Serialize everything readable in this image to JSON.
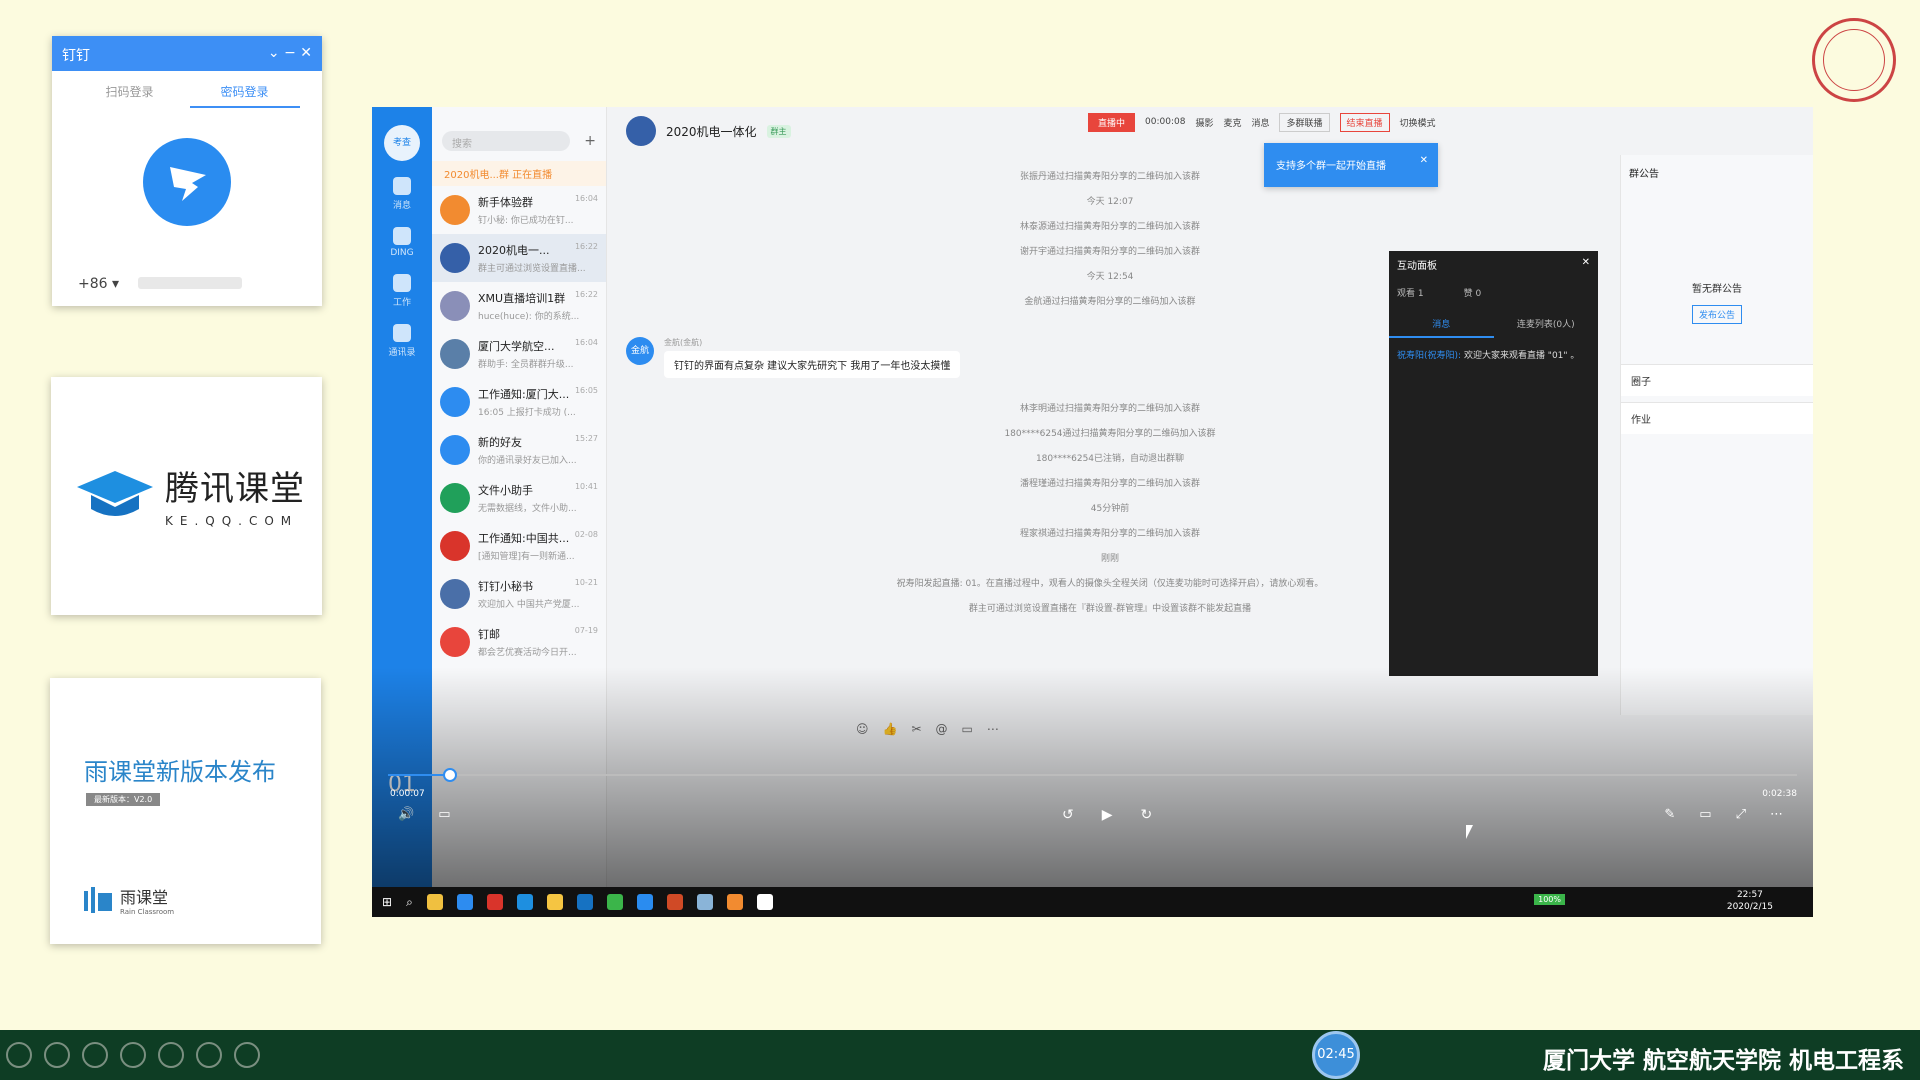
{
  "login": {
    "title": "钉钉",
    "tab_qr": "扫码登录",
    "tab_pwd": "密码登录",
    "country_code": "+86"
  },
  "tencent": {
    "name": "腾讯课堂",
    "domain": "KE.QQ.COM"
  },
  "rain": {
    "title": "雨课堂新版本发布",
    "version": "最新版本：V2.0",
    "brand": "雨课堂",
    "brand_en": "Rain Classroom"
  },
  "app": {
    "rail_top": "考查",
    "rail_items": [
      "消息",
      "DING",
      "工作",
      "通讯录"
    ],
    "rail_number": "01",
    "search_placeholder": "搜索",
    "live_banner": "2020机电...群 正在直播",
    "conversations": [
      {
        "name": "新手体验群",
        "time": "16:04",
        "preview": "钉小秘: 你已成功在钉...",
        "color": "#f28b30"
      },
      {
        "name": "2020机电一...",
        "time": "16:22",
        "preview": "群主可通过浏览设置直播...",
        "color": "#3560a8",
        "selected": true
      },
      {
        "name": "XMU直播培训1群",
        "time": "16:22",
        "preview": "huce(huce): 你的系统...",
        "color": "#8a8fb8"
      },
      {
        "name": "厦门大学航空...",
        "time": "16:04",
        "preview": "群助手: 全员群群升级...",
        "color": "#5a7fa8"
      },
      {
        "name": "工作通知:厦门大...",
        "time": "16:05",
        "preview": "16:05 上报打卡成功 (...",
        "color": "#2d8cf0"
      },
      {
        "name": "新的好友",
        "time": "15:27",
        "preview": "你的通讯录好友已加入...",
        "color": "#2d8cf0"
      },
      {
        "name": "文件小助手",
        "time": "10:41",
        "preview": "无需数据线，文件小助...",
        "color": "#20a05a"
      },
      {
        "name": "工作通知:中国共...",
        "time": "02-08",
        "preview": "[通知管理]有一则新通...",
        "color": "#d9342b"
      },
      {
        "name": "钉钉小秘书",
        "time": "10-21",
        "preview": "欢迎加入 中国共产党厦...",
        "color": "#4a6fa8"
      },
      {
        "name": "钉邮",
        "time": "07-19",
        "preview": "都会艺优赛活动今日开...",
        "color": "#e8453c"
      }
    ],
    "group_title": "2020机电一体化",
    "group_tag": "群主",
    "live_toolbar": {
      "status": "直播中",
      "duration": "00:00:08",
      "camera": "摄影",
      "mic": "麦克",
      "message": "消息",
      "multi": "多群联播",
      "end": "结束直播",
      "mode": "切换模式"
    },
    "tip": "支持多个群一起开始直播",
    "system_messages_top": [
      "张振丹通过扫描黄寿阳分享的二维码加入该群",
      "今天 12:07",
      "林泰源通过扫描黄寿阳分享的二维码加入该群",
      "谢开宇通过扫描黄寿阳分享的二维码加入该群",
      "今天 12:54",
      "金航通过扫描黄寿阳分享的二维码加入该群"
    ],
    "bubble": {
      "avatar": "金航",
      "sender": "金航(金航)",
      "text": "钉钉的界面有点复杂  建议大家先研究下 我用了一年也没太摸懂"
    },
    "system_messages_bottom": [
      "林李明通过扫描黄寿阳分享的二维码加入该群",
      "180****6254通过扫描黄寿阳分享的二维码加入该群",
      "180****6254已注销，自动退出群聊",
      "潘程瑾通过扫描黄寿阳分享的二维码加入该群",
      "45分钟前",
      "程家祺通过扫描黄寿阳分享的二维码加入该群",
      "刚刚",
      "祝寿阳发起直播: 01。在直播过程中，观看人的摄像头全程关闭（仅连麦功能时可选择开启），请放心观看。",
      "群主可通过浏览设置直播在『群设置-群管理』中设置该群不能发起直播"
    ],
    "panel": {
      "title": "互动面板",
      "viewers": "观看 1",
      "likes": "赞 0",
      "tab_msg": "消息",
      "tab_mic": "连麦列表(0人)",
      "msg_user": "祝寿阳(祝寿阳):",
      "msg_text": "欢迎大家来观看直播 \"01\" 。"
    },
    "right": {
      "header": "群公告",
      "empty": "暂无群公告",
      "btn": "发布公告",
      "circle": "圈子",
      "homework": "作业"
    },
    "player": {
      "elapsed": "0:00:07",
      "total": "0:02:38",
      "progress": 0.044
    },
    "clock": {
      "time": "22:57",
      "date": "2020/2/15"
    },
    "battery": "100%"
  },
  "bottom": {
    "timer": "02:45",
    "school": "厦门大学 航空航天学院 机电工程系"
  }
}
